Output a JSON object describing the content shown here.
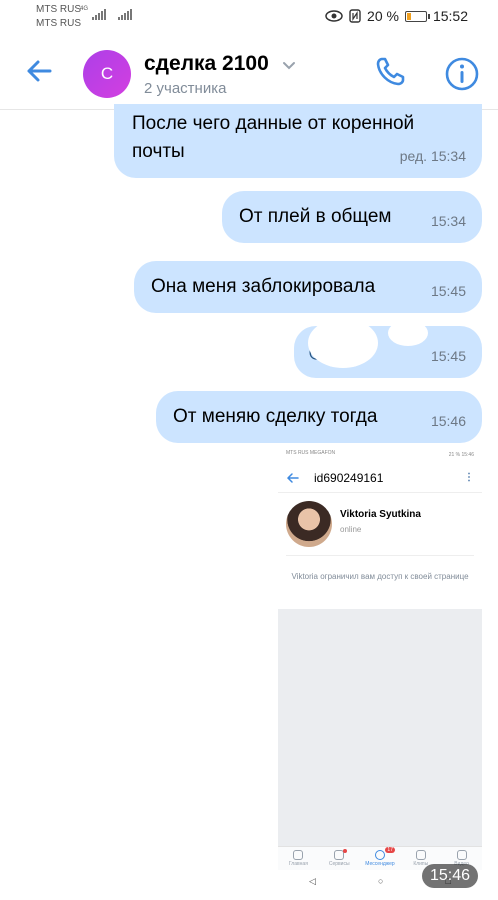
{
  "status_bar": {
    "carrier_1": "MTS RUS",
    "carrier_2": "MTS RUS",
    "network_type": "4G",
    "battery": "20 %",
    "time": "15:52"
  },
  "header": {
    "avatar_letter": "С",
    "title": "сделка 2100",
    "subtitle": "2 участника"
  },
  "messages": [
    {
      "text": "После чего данные от коренной почты",
      "time": "ред. 15:34"
    },
    {
      "text": "От плей в общем",
      "time": "15:34"
    },
    {
      "text": "Она меня заблокировала",
      "time": "15:45"
    },
    {
      "text": "@...015",
      "time": "15:45"
    },
    {
      "text": "От меняю сделку тогда",
      "time": "15:46"
    }
  ],
  "attachment": {
    "status_left": "MTS RUS MEGAFON",
    "status_right": "21 % 15:46",
    "profile_id": "id690249161",
    "profile_name": "Viktoria Syutkina",
    "profile_status": "online",
    "notice": "Viktoria ограничил вам доступ к своей странице",
    "tabs": [
      {
        "label": "Главная"
      },
      {
        "label": "Сервисы"
      },
      {
        "label": "Мессенджер",
        "badge": "17"
      },
      {
        "label": "Клипы"
      },
      {
        "label": "Видео"
      }
    ],
    "time_stamp": "15:46"
  },
  "colors": {
    "accent": "#3f8ae0",
    "bubble": "#cce4ff",
    "avatar": "#c13fe6"
  }
}
